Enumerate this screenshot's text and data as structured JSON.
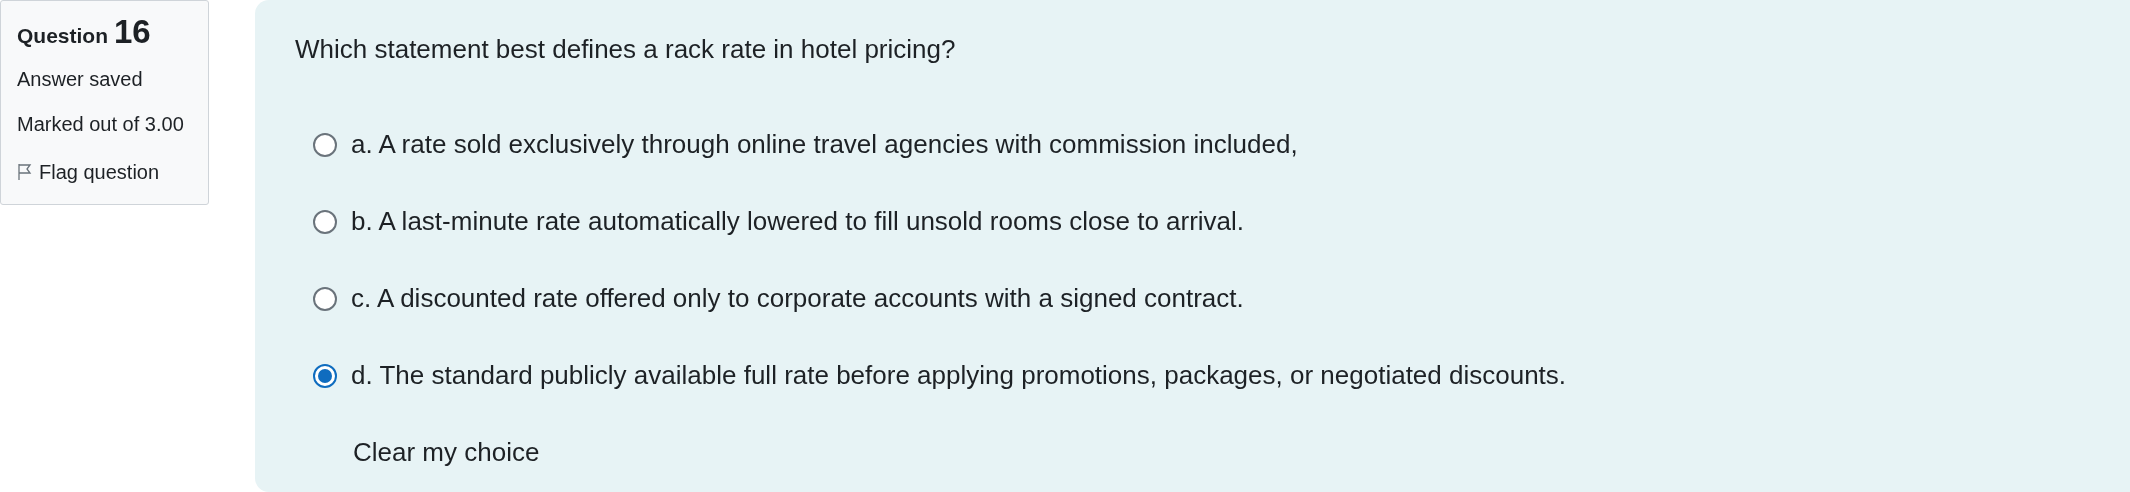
{
  "question_info": {
    "label": "Question",
    "number": "16",
    "status": "Answer saved",
    "marks": "Marked out of 3.00",
    "flag": {
      "label": "Flag question",
      "flagged": false
    }
  },
  "question": {
    "text": "Which statement best defines a rack rate in hotel pricing?",
    "options": [
      {
        "letter": "a.",
        "text": "A rate sold exclusively through online travel agencies with commission included,",
        "selected": false
      },
      {
        "letter": "b.",
        "text": "A last-minute rate automatically lowered to fill unsold rooms close to arrival.",
        "selected": false
      },
      {
        "letter": "c.",
        "text": "A discounted rate offered only to corporate accounts with a signed contract.",
        "selected": false
      },
      {
        "letter": "d.",
        "text": "The standard publicly available full rate before applying promotions, packages, or negotiated discounts.",
        "selected": true
      }
    ],
    "clear_link": "Clear my choice"
  }
}
